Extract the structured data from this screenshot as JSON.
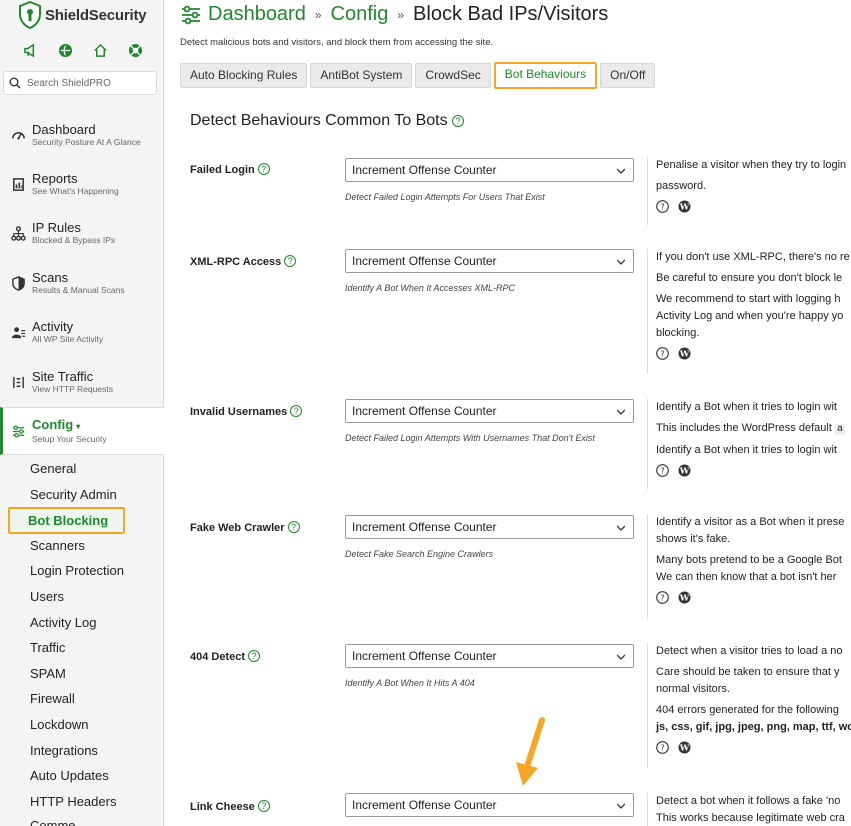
{
  "app": {
    "brand": "ShieldSecurity",
    "search_placeholder": "Search ShieldPRO",
    "accent_color": "#1e8a2c",
    "highlight_color": "#f5a623"
  },
  "sidebar": {
    "quick_icons": [
      "megaphone-icon",
      "globe-icon",
      "home-icon",
      "support-icon"
    ],
    "items": [
      {
        "label": "Dashboard",
        "sub": "Security Posture At A Glance",
        "icon": "dashboard-icon"
      },
      {
        "label": "Reports",
        "sub": "See What's Happening",
        "icon": "reports-icon"
      },
      {
        "label": "IP Rules",
        "sub": "Blocked & Bypass IPs",
        "icon": "ip-rules-icon"
      },
      {
        "label": "Scans",
        "sub": "Results & Manual Scans",
        "icon": "shield-icon"
      },
      {
        "label": "Activity",
        "sub": "All WP Site Activity",
        "icon": "activity-icon"
      },
      {
        "label": "Site Traffic",
        "sub": "View HTTP Requests",
        "icon": "traffic-icon"
      },
      {
        "label": "Config",
        "sub": "Setup Your Security",
        "icon": "config-icon",
        "caret": "▾"
      }
    ],
    "config_subitems": [
      "General",
      "Security Admin",
      "Bot Blocking",
      "Scanners",
      "Login Protection",
      "Users",
      "Activity Log",
      "Traffic",
      "SPAM",
      "Firewall",
      "Lockdown",
      "Integrations",
      "Auto Updates",
      "HTTP Headers",
      "Comme..."
    ]
  },
  "header": {
    "breadcrumb": [
      "Dashboard",
      "Config",
      "Block Bad IPs/Visitors"
    ],
    "separator": "»",
    "description": "Detect malicious bots and visitors, and block them from accessing the site."
  },
  "tabs": [
    "Auto Blocking Rules",
    "AntiBot System",
    "CrowdSec",
    "Bot Behaviours",
    "On/Off"
  ],
  "section_title": "Detect Behaviours Common To Bots",
  "options": [
    {
      "label": "Failed Login",
      "value": "Increment Offense Counter",
      "hint": "Detect Failed Login Attempts For Users That Exist",
      "desc": [
        "Penalise a visitor when they try to login",
        "password."
      ]
    },
    {
      "label": "XML-RPC Access",
      "value": "Increment Offense Counter",
      "hint": "Identify A Bot When It Accesses XML-RPC",
      "desc": [
        "If you don't use XML-RPC, there's no re",
        "Be careful to ensure you don't block le",
        "We recommend to start with logging h",
        "Activity Log and when you're happy yo",
        "blocking."
      ]
    },
    {
      "label": "Invalid Usernames",
      "value": "Increment Offense Counter",
      "hint": "Detect Failed Login Attempts With Usernames That Don't Exist",
      "desc": [
        "Identify a Bot when it tries to login wit",
        "This includes the WordPress default",
        "Identify a Bot when it tries to login wit"
      ]
    },
    {
      "label": "Fake Web Crawler",
      "value": "Increment Offense Counter",
      "hint": "Detect Fake Search Engine Crawlers",
      "desc": [
        "Identify a visitor as a Bot when it prese",
        "shows it's fake.",
        "Many bots pretend to be a Google Bot",
        "We can then know that a bot isn't her"
      ]
    },
    {
      "label": "404 Detect",
      "value": "Increment Offense Counter",
      "hint": "Identify A Bot When It Hits A 404",
      "desc": [
        "Detect when a visitor tries to load a no",
        "Care should be taken to ensure that y",
        "normal visitors.",
        "404 errors generated for the following",
        "js, css, gif, jpg, jpeg, png, map, ttf, wo"
      ]
    },
    {
      "label": "Link Cheese",
      "value": "Increment Offense Counter",
      "hint": "",
      "desc": [
        "Detect a bot when it follows a fake 'no",
        "This works because legitimate web cra"
      ]
    }
  ]
}
